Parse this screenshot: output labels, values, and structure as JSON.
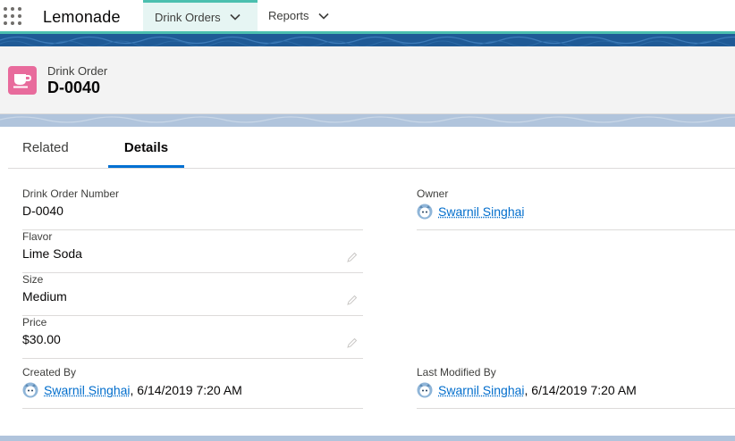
{
  "app": {
    "name": "Lemonade"
  },
  "nav": {
    "tabs": [
      {
        "label": "Drink Orders",
        "active": true
      },
      {
        "label": "Reports",
        "active": false
      }
    ]
  },
  "header": {
    "object_type": "Drink Order",
    "record_title": "D-0040",
    "icon": "cup-icon",
    "icon_color": "#e86b9c"
  },
  "tabs": [
    {
      "label": "Related",
      "active": false
    },
    {
      "label": "Details",
      "active": true
    }
  ],
  "fields": {
    "drink_order_number": {
      "label": "Drink Order Number",
      "value": "D-0040"
    },
    "owner": {
      "label": "Owner",
      "value": "Swarnil Singhai"
    },
    "flavor": {
      "label": "Flavor",
      "value": "Lime Soda"
    },
    "size": {
      "label": "Size",
      "value": "Medium"
    },
    "price": {
      "label": "Price",
      "value": "$30.00"
    },
    "created_by": {
      "label": "Created By",
      "user": "Swarnil Singhai",
      "timestamp": ", 6/14/2019 7:20 AM"
    },
    "last_modified_by": {
      "label": "Last Modified By",
      "user": "Swarnil Singhai",
      "timestamp": ", 6/14/2019 7:20 AM"
    }
  },
  "colors": {
    "accent": "#4bbfaf",
    "link": "#006dcc",
    "active_tab_underline": "#0070d2",
    "band": "#1f5a96"
  }
}
